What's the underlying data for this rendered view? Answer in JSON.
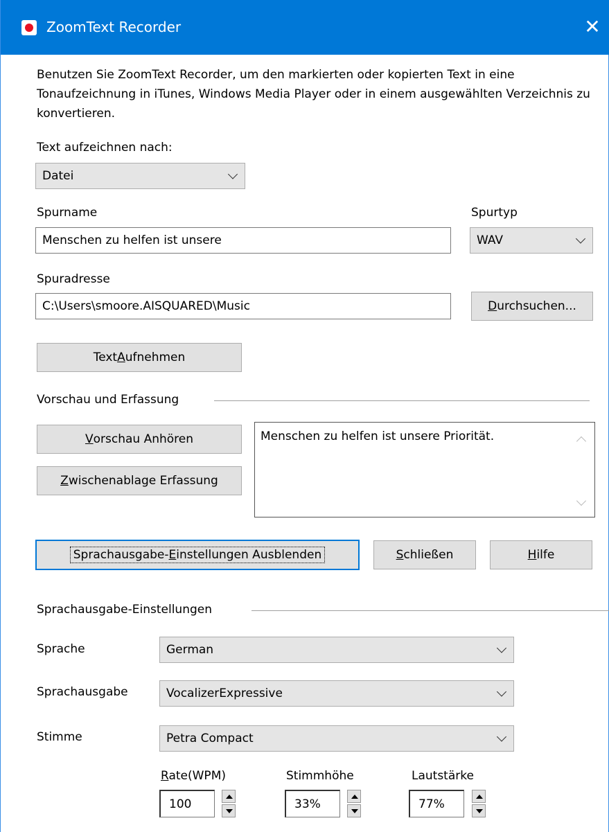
{
  "window": {
    "title": "ZoomText Recorder",
    "close_glyph": "✕",
    "accent_color": "#0078d7"
  },
  "description": "Benutzen Sie ZoomText Recorder, um den markierten oder kopierten Text in eine Tonaufzeichnung in iTunes, Windows Media Player oder in einem ausgewählten Verzeichnis zu konvertieren.",
  "record_to": {
    "label": "Text aufzeichnen nach:",
    "value": "Datei"
  },
  "track_name": {
    "label": "Spurname",
    "value": "Menschen zu helfen ist unsere"
  },
  "track_type": {
    "label": "Spurtyp",
    "value": "WAV"
  },
  "track_address": {
    "label": "Spuradresse",
    "value": "C:\\Users\\smoore.AISQUARED\\Music"
  },
  "browse_button": {
    "pre": "",
    "key": "D",
    "post": "urchsuchen..."
  },
  "record_button": {
    "pre": "Text ",
    "key": "A",
    "post": "ufnehmen"
  },
  "preview_group": {
    "title": "Vorschau und Erfassung",
    "listen_button": {
      "pre": "",
      "key": "V",
      "post": "orschau Anhören"
    },
    "clipboard_button": {
      "pre": "",
      "key": "Z",
      "post": "wischenablage Erfassung"
    },
    "text": "Menschen zu helfen ist unsere Priorität."
  },
  "actions": {
    "hide_speech": {
      "pre": "Sprachausgabe-",
      "key": "E",
      "post": "instellungen Ausblenden"
    },
    "close": {
      "pre": "",
      "key": "S",
      "post": "chließen"
    },
    "help": {
      "pre": "",
      "key": "H",
      "post": "ilfe"
    }
  },
  "speech_group": {
    "title": "Sprachausgabe-Einstellungen",
    "language": {
      "label": "Sprache",
      "value": "German"
    },
    "synthesizer": {
      "label": "Sprachausgabe",
      "value": "VocalizerExpressive"
    },
    "voice": {
      "label": "Stimme",
      "value": "Petra Compact"
    },
    "rate": {
      "label_key": "R",
      "label_rest": "ate(WPM)",
      "value": "100"
    },
    "pitch": {
      "label": "Stimmhöhe",
      "value": "33%"
    },
    "volume": {
      "label": "Lautstärke",
      "value": "77%"
    }
  }
}
